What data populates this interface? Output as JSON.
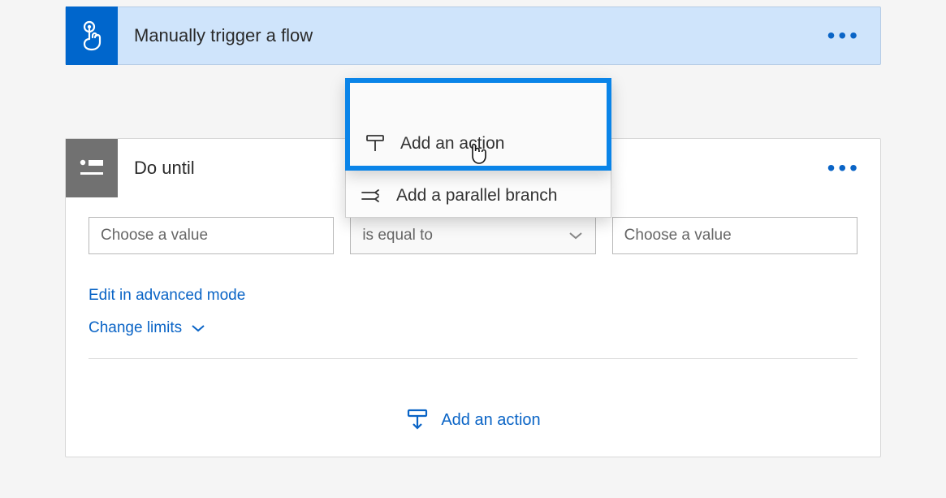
{
  "trigger": {
    "title": "Manually trigger a flow"
  },
  "doUntil": {
    "title": "Do until",
    "leftPlaceholder": "Choose a value",
    "operator": "is equal to",
    "rightPlaceholder": "Choose a value",
    "editAdvanced": "Edit in advanced mode",
    "changeLimits": "Change limits",
    "addAction": "Add an action"
  },
  "popover": {
    "addAction": "Add an action",
    "addParallel": "Add a parallel branch"
  },
  "colors": {
    "primary": "#0a64c6",
    "accent": "#0a84e8",
    "triggerBg": "#cfe4fb",
    "doUntilIcon": "#717171"
  }
}
